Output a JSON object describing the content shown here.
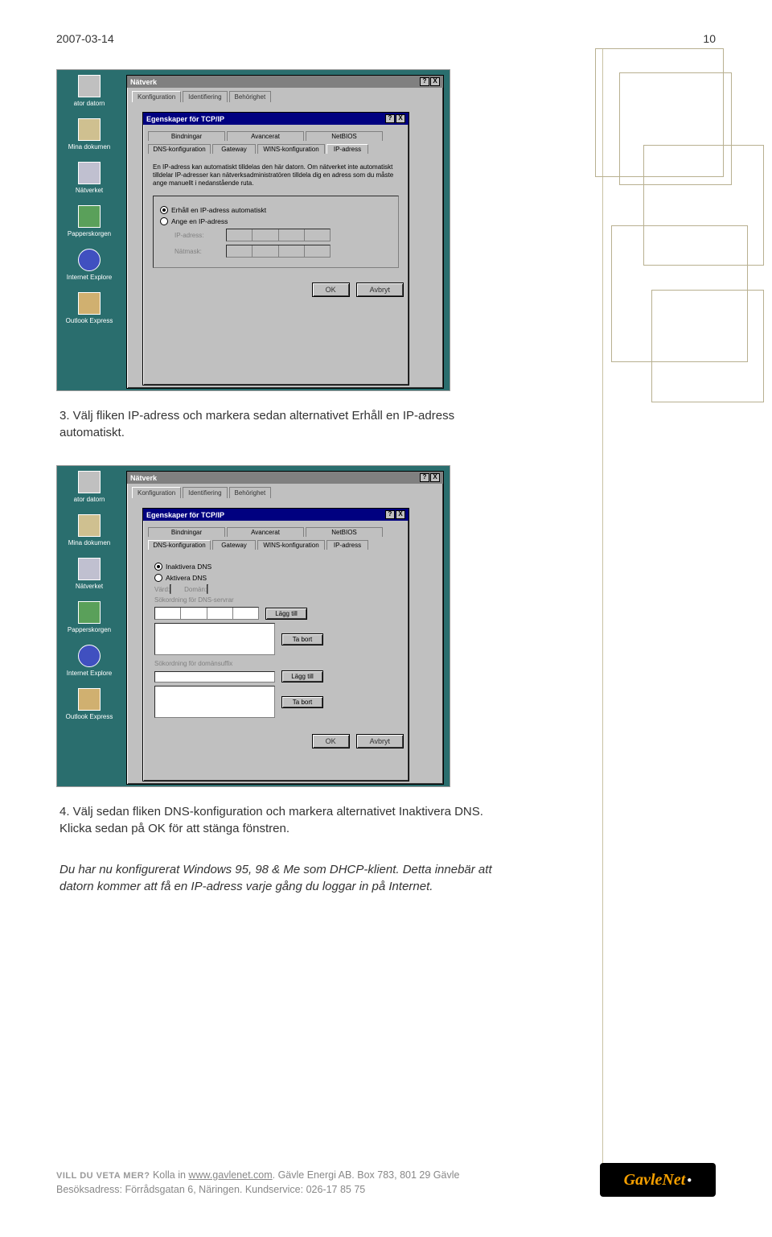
{
  "header": {
    "date": "2007-03-14",
    "page": "10"
  },
  "step3": "3. Välj fliken IP-adress och markera sedan alternativet Erhåll en IP-adress automatiskt.",
  "step4": "4. Välj sedan fliken DNS-konfiguration och markera alternativet Inaktivera DNS. Klicka sedan på OK för att stänga fönstren.",
  "summary": "Du har nu konfigurerat Windows 95, 98 & Me som DHCP-klient. Detta innebär att datorn kommer att få en IP-adress varje gång du loggar in på Internet.",
  "desktop_icons": [
    "ator datorn",
    "Mina dokumen",
    "Nätverket",
    "Papperskorgen",
    "Internet Explore",
    "Outlook Express"
  ],
  "win_natverk": {
    "title": "Nätverk",
    "tabs": [
      "Konfiguration",
      "Identifiering",
      "Behörighet"
    ]
  },
  "win_tcpip": {
    "title": "Egenskaper för TCP/IP",
    "sub_tabs_row1": [
      "Bindningar",
      "Avancerat",
      "NetBIOS"
    ],
    "sub_tabs_row2": [
      "DNS-konfiguration",
      "Gateway",
      "WINS-konfiguration",
      "IP-adress"
    ],
    "info": "En IP-adress kan automatiskt tilldelas den här datorn. Om nätverket inte automatiskt tilldelar IP-adresser kan nätverksadministratören tilldela dig en adress som du måste ange manuellt i nedanstående ruta.",
    "radio1": "Erhåll en IP-adress automatiskt",
    "radio2": "Ange en IP-adress",
    "ip_label": "IP-adress:",
    "mask_label": "Nätmask:",
    "ok": "OK",
    "cancel": "Avbryt"
  },
  "win_dns": {
    "radio1": "Inaktivera DNS",
    "radio2": "Aktivera DNS",
    "host_label": "Värd:",
    "domain_label": "Domän:",
    "search_dns": "Sökordning för DNS-servrar",
    "search_suffix": "Sökordning för domänsuffix",
    "add": "Lägg till",
    "remove": "Ta bort"
  },
  "footer": {
    "lead": "VILL DU VETA MER?",
    "line1_a": " Kolla in ",
    "line1_b": "www.gavlenet.com",
    "line1_c": ". Gävle Energi AB. Box 783, 801 29 Gävle",
    "line2": "Besöksadress: Förrådsgatan 6, Näringen. Kundservice: 026-17 85 75",
    "logo": "GavleNet"
  }
}
